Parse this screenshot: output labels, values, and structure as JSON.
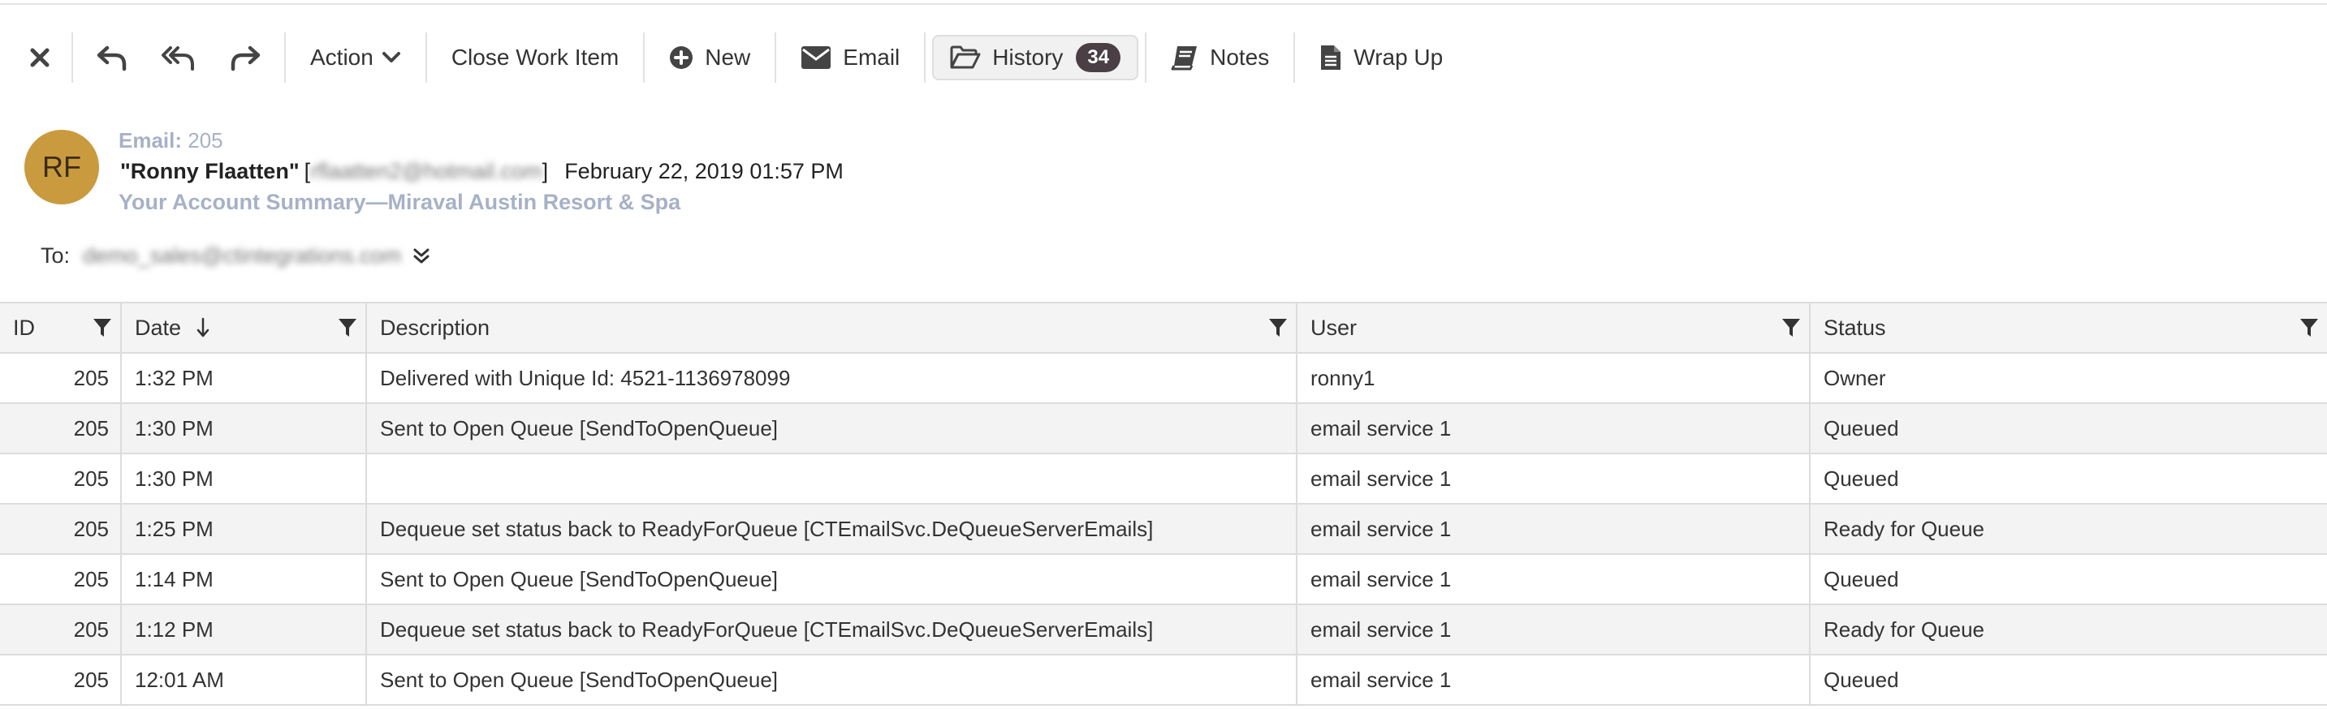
{
  "toolbar": {
    "close_icon": "close-icon",
    "reply_icon": "reply-icon",
    "reply_all_icon": "reply-all-icon",
    "forward_icon": "forward-icon",
    "action_label": "Action",
    "close_work_item_label": "Close Work Item",
    "new_label": "New",
    "email_label": "Email",
    "history_label": "History",
    "history_count": "34",
    "notes_label": "Notes",
    "wrap_up_label": "Wrap Up"
  },
  "email": {
    "avatar_initials": "RF",
    "avatar_color": "#c99a3e",
    "id_label": "Email:",
    "id_value": "205",
    "sender_name": "\"Ronny Flaatten\"",
    "sender_email": "rflaatten2@hotmail.com",
    "date": "February 22, 2019 01:57 PM",
    "subject": "Your Account Summary—Miraval Austin Resort & Spa",
    "to_label": "To:",
    "to_address": "demo_sales@ctintegrations.com"
  },
  "history_table": {
    "columns": {
      "id": "ID",
      "date": "Date",
      "description": "Description",
      "user": "User",
      "status": "Status"
    },
    "rows": [
      {
        "id": "205",
        "date": "1:32 PM",
        "description": "Delivered with Unique Id: 4521-1136978099",
        "user": "ronny1",
        "status": "Owner"
      },
      {
        "id": "205",
        "date": "1:30 PM",
        "description": "Sent to Open Queue [SendToOpenQueue]",
        "user": "email service 1",
        "status": "Queued"
      },
      {
        "id": "205",
        "date": "1:30 PM",
        "description": "",
        "user": "email service 1",
        "status": "Queued"
      },
      {
        "id": "205",
        "date": "1:25 PM",
        "description": "Dequeue set status back to ReadyForQueue [CTEmailSvc.DeQueueServerEmails]",
        "user": "email service 1",
        "status": "Ready for Queue"
      },
      {
        "id": "205",
        "date": "1:14 PM",
        "description": "Sent to Open Queue [SendToOpenQueue]",
        "user": "email service 1",
        "status": "Queued"
      },
      {
        "id": "205",
        "date": "1:12 PM",
        "description": "Dequeue set status back to ReadyForQueue [CTEmailSvc.DeQueueServerEmails]",
        "user": "email service 1",
        "status": "Ready for Queue"
      },
      {
        "id": "205",
        "date": "12:01 AM",
        "description": "Sent to Open Queue [SendToOpenQueue]",
        "user": "email service 1",
        "status": "Queued"
      }
    ]
  }
}
